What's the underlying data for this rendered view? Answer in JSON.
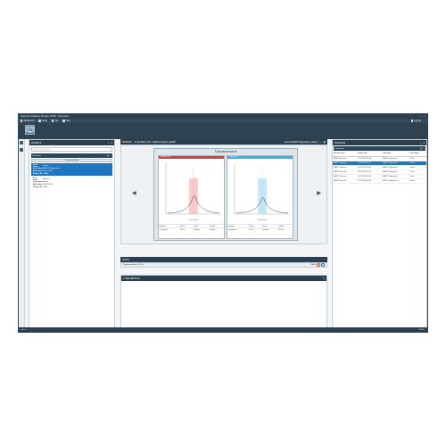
{
  "window": {
    "title": "Diagnostic Database Manager (DDM) - Diagnostics",
    "controls": [
      "–",
      "□",
      "×"
    ]
  },
  "menu": {
    "items": [
      {
        "label": "Workbench"
      },
      {
        "label": "Setup"
      },
      {
        "label": "File"
      },
      {
        "label": "Help"
      }
    ],
    "login": "Log out"
  },
  "patients": {
    "header": "PATIENTS",
    "search_placeholder": "Type here to search",
    "selected_count": "2 Records",
    "connect_label": "Connected data",
    "cards": [
      {
        "selected": true,
        "fields": [
          {
            "k": "First name",
            "v": "Quem"
          },
          {
            "k": "Last name",
            "v": "MAICO Diagnostics"
          },
          {
            "k": "Birth date",
            "v": "01.01.1957"
          },
          {
            "k": "Patient Id",
            "v": "75680"
          }
        ]
      },
      {
        "selected": false,
        "fields": [
          {
            "k": "First name",
            "v": "Martina"
          },
          {
            "k": "Last name",
            "v": "Brune"
          },
          {
            "k": "Birth date",
            "v": "09.09.2019"
          },
          {
            "k": "Patient Id",
            "v": "7869"
          }
        ]
      }
    ]
  },
  "session": {
    "header": "SESSION",
    "info": "27.06.2019 17:07 - MAICO Session, M-IMP",
    "right_label": "Demo MAICO Diagnostics [ admin ]",
    "chart_title": "Tympanometrie",
    "tests_label": "TESTS",
    "test_row": "Tympanometrie 226 Hz",
    "test_status": "PASS",
    "description_label": "DESCRIPTION",
    "left_ear": {
      "bar": "Rechtes Ohr",
      "rows": [
        {
          "a": "Volumen",
          "b": "1.00 ml",
          "c": "Druck",
          "d": "-1 daPa"
        },
        {
          "a": "Compliance",
          "b": "0.82 ml",
          "c": "Gradient",
          "d": "43 daPa"
        }
      ],
      "xlabel": "Druck daPa"
    },
    "right_ear": {
      "bar": "Linkes Ohr",
      "rows": [
        {
          "a": "Volumen",
          "b": "1.20 ml",
          "c": "Druck",
          "d": "-1 daPa"
        },
        {
          "a": "Compliance",
          "b": "0.75 ml",
          "c": "Gradient",
          "d": "40 daPa"
        }
      ],
      "xlabel": "Druck daPa"
    }
  },
  "sessions": {
    "header": "SESSIONS",
    "count": "6 Sessions",
    "columns": [
      "Session name",
      "Create date",
      "Last name",
      "First name"
    ],
    "rows": [
      [
        "MAICO Sessions",
        "28.06.2019 17:40",
        "MAICO Diagnostics",
        "Demo"
      ],
      [
        "MAICO Sessions",
        "27.06.2019 17:07",
        "MAICO Diagnostics",
        "Demo"
      ],
      [
        "MAICO Sessions",
        "03.12.2018 16:07",
        "MAICO Diagnostics",
        "Demo"
      ],
      [
        "MAICO Sessions",
        "03.12.2018 15:56",
        "MAICO Diagnostics",
        "Demo"
      ],
      [
        "MAICO Sessions",
        "03.12.2018 09:50",
        "MAICO Diagnostics",
        "Demo"
      ],
      [
        "MAICO Sessions",
        "03.12.2018 09:44",
        "MAICO Diagnostics",
        "Demo"
      ]
    ],
    "selected_index": 1
  },
  "status": {
    "left": "admin",
    "right": "READY"
  },
  "colors": {
    "accent": "#1f76c0",
    "dark": "#2b3f4e",
    "right_ear": "#e53935",
    "left_ear": "#29b6f6"
  },
  "icons": [
    "monitor-icon",
    "user-icon",
    "settings-icon",
    "home-icon",
    "edit-icon"
  ]
}
